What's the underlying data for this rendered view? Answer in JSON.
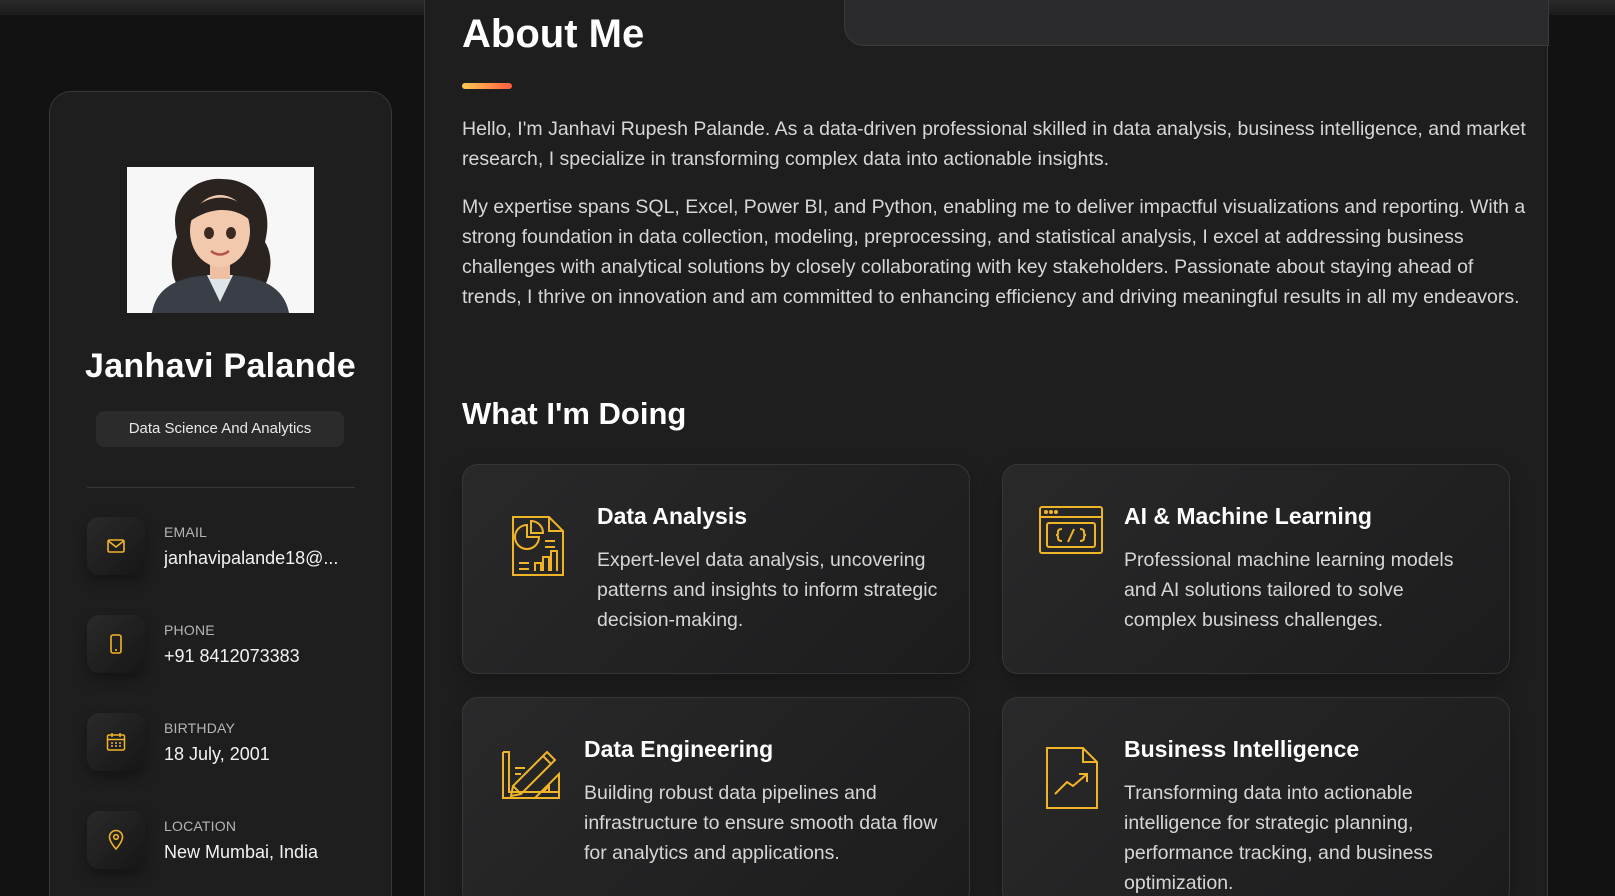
{
  "profile": {
    "name": "Janhavi Palande",
    "title": "Data Science And Analytics"
  },
  "contacts": [
    {
      "label": "EMAIL",
      "value": "janhavipalande18@...",
      "icon": "mail-icon"
    },
    {
      "label": "PHONE",
      "value": "+91 8412073383",
      "icon": "phone-icon"
    },
    {
      "label": "BIRTHDAY",
      "value": "18 July, 2001",
      "icon": "calendar-icon"
    },
    {
      "label": "LOCATION",
      "value": "New Mumbai, India",
      "icon": "location-pin-icon"
    }
  ],
  "about": {
    "heading": "About Me",
    "paragraph1": "Hello, I'm Janhavi Rupesh Palande. As a data-driven professional skilled in data analysis, business intelligence, and market research, I specialize in transforming complex data into actionable insights.",
    "paragraph2": "My expertise spans SQL, Excel, Power BI, and Python, enabling me to deliver impactful visualizations and reporting. With a strong foundation in data collection, modeling, preprocessing, and statistical analysis, I excel at addressing business challenges with analytical solutions by closely collaborating with key stakeholders. Passionate about staying ahead of trends, I thrive on innovation and am committed to enhancing efficiency and driving meaningful results in all my endeavors."
  },
  "services": {
    "heading": "What I'm Doing",
    "items": [
      {
        "title": "Data Analysis",
        "text": "Expert-level data analysis, uncovering patterns and insights to inform strategic decision-making.",
        "icon": "data-analysis-icon"
      },
      {
        "title": "AI & Machine Learning",
        "text": "Professional machine learning models and AI solutions tailored to solve complex business challenges.",
        "icon": "code-window-icon"
      },
      {
        "title": "Data Engineering",
        "text": "Building robust data pipelines and infrastructure to ensure smooth data flow for analytics and applications.",
        "icon": "design-tools-icon"
      },
      {
        "title": "Business Intelligence",
        "text": "Transforming data into actionable intelligence for strategic planning, performance tracking, and business optimization.",
        "icon": "trend-document-icon"
      }
    ]
  },
  "colors": {
    "accent": "#f0b429",
    "background": "#121212",
    "panel": "#1e1e1f",
    "gradient_start": "#ffcc55",
    "gradient_end": "#ff5b3f"
  }
}
